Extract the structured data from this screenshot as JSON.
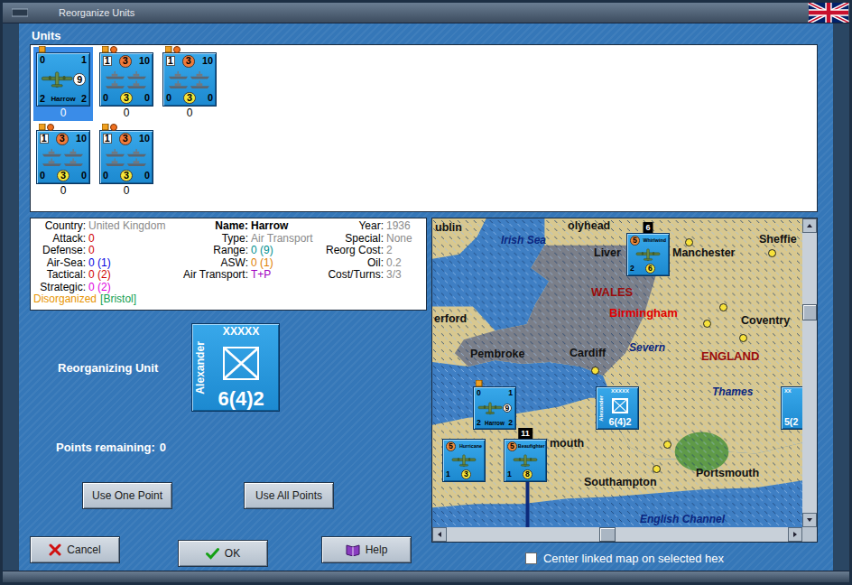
{
  "window": {
    "title": "Reorganize Units"
  },
  "units_panel": {
    "label": "Units",
    "units": [
      {
        "kind": "transport",
        "selected": true,
        "top_left": "0",
        "top_right": "1",
        "circle": "9",
        "bottom_left": "2",
        "name": "Harrow",
        "bottom_right": "2",
        "count": "0"
      },
      {
        "kind": "naval",
        "selected": false,
        "top_left": "1",
        "attack": "3",
        "top_right": "10",
        "bottom_left": "0",
        "defense": "3",
        "bottom_right": "0",
        "count": "0"
      },
      {
        "kind": "naval",
        "selected": false,
        "top_left": "1",
        "attack": "3",
        "top_right": "10",
        "bottom_left": "0",
        "defense": "3",
        "bottom_right": "0",
        "count": "0"
      },
      {
        "kind": "naval",
        "selected": false,
        "top_left": "1",
        "attack": "3",
        "top_right": "10",
        "bottom_left": "0",
        "defense": "3",
        "bottom_right": "0",
        "count": "0"
      },
      {
        "kind": "naval",
        "selected": false,
        "top_left": "1",
        "attack": "3",
        "top_right": "10",
        "bottom_left": "0",
        "defense": "3",
        "bottom_right": "0",
        "count": "0"
      }
    ]
  },
  "info": {
    "columns": [
      [
        {
          "label": "Country:",
          "value": "United Kingdom",
          "color": "#8a8a8a",
          "emphasis": false
        },
        {
          "label": "Attack:",
          "value": "0",
          "color": "#d00000",
          "emphasis": false
        },
        {
          "label": "Defense:",
          "value": "0",
          "color": "#d00000",
          "emphasis": false
        },
        {
          "label": "Air-Sea:",
          "value": "0 (1)",
          "color": "#0000e0",
          "emphasis": false
        },
        {
          "label": "Tactical:",
          "value": "0 (2)",
          "color": "#d00000",
          "emphasis": false
        },
        {
          "label": "Strategic:",
          "value": "0 (2)",
          "color": "#e000e0",
          "emphasis": false
        }
      ],
      [
        {
          "label": "Name:",
          "value": "Harrow",
          "color": "#000000",
          "emphasis": true
        },
        {
          "label": "Type:",
          "value": "Air Transport",
          "color": "#8a8a8a",
          "emphasis": false
        },
        {
          "label": "Range:",
          "value": "0 (9)",
          "color": "#009090",
          "emphasis": false
        },
        {
          "label": "ASW:",
          "value": "0 (1)",
          "color": "#e08000",
          "emphasis": false
        },
        {
          "label": "Air Transport:",
          "value": "T+P",
          "color": "#a000c0",
          "emphasis": false
        }
      ],
      [
        {
          "label": "Year:",
          "value": "1936",
          "color": "#8a8a8a",
          "emphasis": false
        },
        {
          "label": "Special:",
          "value": "None",
          "color": "#8a8a8a",
          "emphasis": false
        },
        {
          "label": "Reorg Cost:",
          "value": "2",
          "color": "#8a8a8a",
          "emphasis": false
        },
        {
          "label": "Oil:",
          "value": "0.2",
          "color": "#8a8a8a",
          "emphasis": false
        },
        {
          "label": "Cost/Turns:",
          "value": "3/3",
          "color": "#8a8a8a",
          "emphasis": false
        }
      ]
    ],
    "status": [
      {
        "text": "Disorganized",
        "color": "#e89400"
      },
      {
        "text": "[Bristol]",
        "color": "#10a050"
      }
    ]
  },
  "reorganizing": {
    "label": "Reorganizing Unit",
    "unit": {
      "kind": "hq",
      "corps": "XXXXX",
      "name": "Alexander",
      "strength": "6(4)2"
    }
  },
  "points": {
    "label": "Points remaining:",
    "value": "0"
  },
  "point_buttons": [
    "Use One Point",
    "Use All Points"
  ],
  "dialog_buttons": [
    {
      "label": "Cancel",
      "kind": "cancel"
    },
    {
      "label": "OK",
      "kind": "ok"
    },
    {
      "label": "Help",
      "kind": "help"
    }
  ],
  "map": {
    "labels": [
      {
        "text": "Irish Sea",
        "kind": "water"
      },
      {
        "text": "olyhead",
        "kind": "city"
      },
      {
        "text": "ublin",
        "kind": "city"
      },
      {
        "text": "Liver",
        "kind": "city"
      },
      {
        "text": "Manchester",
        "kind": "city"
      },
      {
        "text": "Sheffie",
        "kind": "city"
      },
      {
        "text": "WALES",
        "kind": "region"
      },
      {
        "text": "Birmingham",
        "kind": "capital"
      },
      {
        "text": "Coventry",
        "kind": "city"
      },
      {
        "text": "erford",
        "kind": "city"
      },
      {
        "text": "Pembroke",
        "kind": "city"
      },
      {
        "text": "Cardiff",
        "kind": "city"
      },
      {
        "text": "Severn",
        "kind": "water"
      },
      {
        "text": "ENGLAND",
        "kind": "region"
      },
      {
        "text": "Thames",
        "kind": "water"
      },
      {
        "text": "mouth",
        "kind": "city"
      },
      {
        "text": "Southampton",
        "kind": "city"
      },
      {
        "text": "Portsmouth",
        "kind": "city"
      },
      {
        "text": "English Channel",
        "kind": "water"
      }
    ],
    "units": [
      {
        "kind": "fighter",
        "name": "Whirlwind",
        "attack": "5",
        "bottom_left": "2",
        "range": "6",
        "stack": "6"
      },
      {
        "kind": "transport",
        "name": "Harrow",
        "top_left": "0",
        "top_right": "1",
        "circle": "9",
        "bottom_left": "2",
        "bottom_right": "2"
      },
      {
        "kind": "hq",
        "corps": "XXXXX",
        "name": "Alexander",
        "strength": "6(4)2"
      },
      {
        "kind": "fighter",
        "name": "Hurricane",
        "attack": "5",
        "bottom_left": "1",
        "range": "3"
      },
      {
        "kind": "fighter",
        "name": "Beaufighter",
        "attack": "5",
        "bottom_left": "1",
        "range": "8",
        "stack": "11"
      },
      {
        "kind": "edge",
        "corps": "XX",
        "strength": "5(2"
      }
    ],
    "scroll": {
      "horizontal": 0.47,
      "vertical": 0.27
    }
  },
  "center_checkbox": {
    "label": "Center linked map on selected hex",
    "checked": false
  }
}
